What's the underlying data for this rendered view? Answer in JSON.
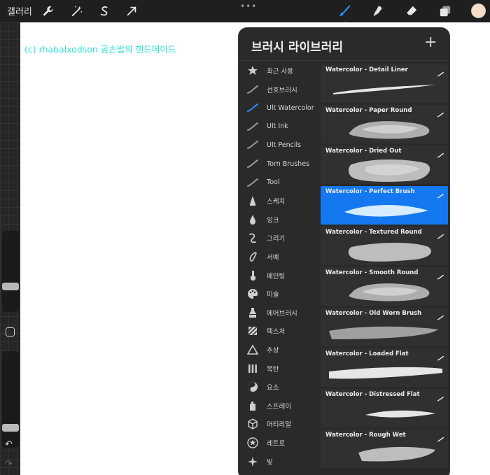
{
  "toolbar": {
    "gallery_label": "갤러리",
    "left_icons": [
      "wrench-icon",
      "magic-wand-icon",
      "selection-icon",
      "transform-arrow-icon"
    ],
    "more_menu": "•••",
    "right_icons": [
      "brush-icon",
      "smudge-icon",
      "eraser-icon",
      "layers-icon"
    ],
    "active_tool": "brush",
    "active_color": "#f6ddc5"
  },
  "sidebar": {
    "size_slider_value": 0.7,
    "opacity_slider_value": 0.82,
    "undo_icon": "↶",
    "redo_icon": "↷"
  },
  "canvas": {
    "watermark": "(c) rhabalxodson 곰손발의 핸드메이드",
    "watermark_color": "#35e0d8"
  },
  "brush_library": {
    "title": "브러시 라이브러리",
    "add_icon": "+",
    "categories": [
      {
        "label": "최근 사용",
        "icon": "star-icon"
      },
      {
        "label": "선호브러시",
        "icon": "brush-stroke-icon"
      },
      {
        "label": "Ult Watercolor",
        "icon": "brush-stroke-icon",
        "selected": true
      },
      {
        "label": "Ult Ink",
        "icon": "brush-stroke-icon"
      },
      {
        "label": "Ult Pencils",
        "icon": "brush-stroke-icon"
      },
      {
        "label": "Torn Brushes",
        "icon": "brush-stroke-icon"
      },
      {
        "label": "Tool",
        "icon": "brush-stroke-icon"
      },
      {
        "label": "스케치",
        "icon": "pencil-tip-icon"
      },
      {
        "label": "잉크",
        "icon": "ink-drop-icon"
      },
      {
        "label": "그리기",
        "icon": "squiggle-icon"
      },
      {
        "label": "서예",
        "icon": "calligraphy-icon"
      },
      {
        "label": "페인팅",
        "icon": "paint-brush-icon"
      },
      {
        "label": "미술",
        "icon": "palette-icon"
      },
      {
        "label": "에어브러시",
        "icon": "airbrush-icon"
      },
      {
        "label": "텍스처",
        "icon": "texture-icon"
      },
      {
        "label": "추상",
        "icon": "triangle-icon"
      },
      {
        "label": "목탄",
        "icon": "charcoal-icon"
      },
      {
        "label": "요소",
        "icon": "yin-yang-icon"
      },
      {
        "label": "스프레이",
        "icon": "spray-can-icon"
      },
      {
        "label": "머티리얼",
        "icon": "cube-icon"
      },
      {
        "label": "레트로",
        "icon": "retro-star-icon"
      },
      {
        "label": "빛",
        "icon": "sparkle-icon"
      }
    ],
    "brushes": [
      {
        "name": "Watercolor - Detail Liner",
        "stroke": "thin"
      },
      {
        "name": "Watercolor - Paper Round",
        "stroke": "cloud"
      },
      {
        "name": "Watercolor - Dried Out",
        "stroke": "blob"
      },
      {
        "name": "Watercolor - Perfect Brush",
        "stroke": "leaf",
        "selected": true
      },
      {
        "name": "Watercolor - Textured Round",
        "stroke": "bar"
      },
      {
        "name": "Watercolor - Smooth Round",
        "stroke": "cloud"
      },
      {
        "name": "Watercolor - Old Worn Brush",
        "stroke": "worn"
      },
      {
        "name": "Watercolor - Loaded Flat",
        "stroke": "flat"
      },
      {
        "name": "Watercolor - Distressed Flat",
        "stroke": "wisp"
      },
      {
        "name": "Watercolor - Rough Wet",
        "stroke": "rough"
      }
    ]
  }
}
